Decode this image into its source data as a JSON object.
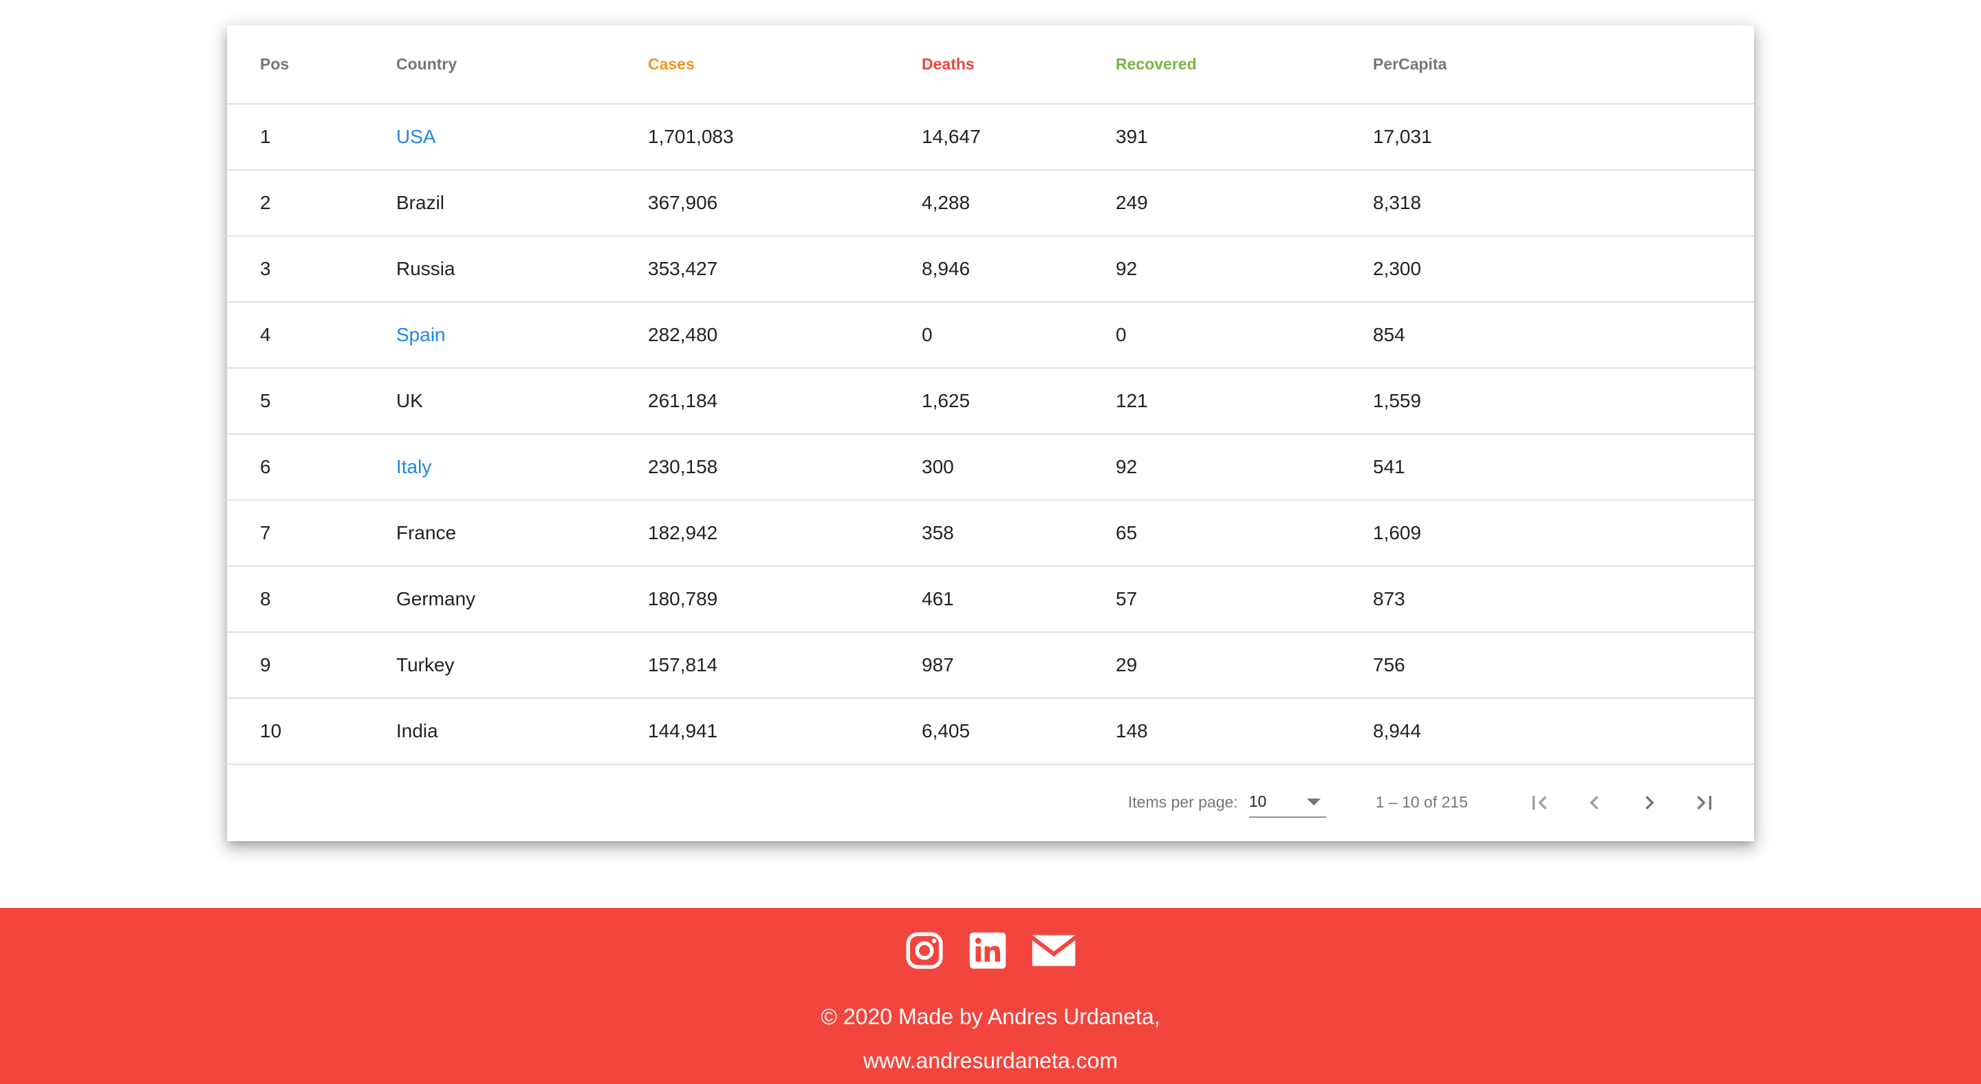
{
  "colors": {
    "cases": "#f7931e",
    "deaths": "#f2453d",
    "recovered": "#7cb342",
    "link": "#1e88e5",
    "footer_bg": "#f2453d"
  },
  "table": {
    "columns": [
      "Pos",
      "Country",
      "Cases",
      "Deaths",
      "Recovered",
      "PerCapita"
    ],
    "rows": [
      {
        "pos": "1",
        "country": "USA",
        "linked": true,
        "cases": "1,701,083",
        "deaths": "14,647",
        "recovered": "391",
        "percapita": "17,031"
      },
      {
        "pos": "2",
        "country": "Brazil",
        "linked": false,
        "cases": "367,906",
        "deaths": "4,288",
        "recovered": "249",
        "percapita": "8,318"
      },
      {
        "pos": "3",
        "country": "Russia",
        "linked": false,
        "cases": "353,427",
        "deaths": "8,946",
        "recovered": "92",
        "percapita": "2,300"
      },
      {
        "pos": "4",
        "country": "Spain",
        "linked": true,
        "cases": "282,480",
        "deaths": "0",
        "recovered": "0",
        "percapita": "854"
      },
      {
        "pos": "5",
        "country": "UK",
        "linked": false,
        "cases": "261,184",
        "deaths": "1,625",
        "recovered": "121",
        "percapita": "1,559"
      },
      {
        "pos": "6",
        "country": "Italy",
        "linked": true,
        "cases": "230,158",
        "deaths": "300",
        "recovered": "92",
        "percapita": "541"
      },
      {
        "pos": "7",
        "country": "France",
        "linked": false,
        "cases": "182,942",
        "deaths": "358",
        "recovered": "65",
        "percapita": "1,609"
      },
      {
        "pos": "8",
        "country": "Germany",
        "linked": false,
        "cases": "180,789",
        "deaths": "461",
        "recovered": "57",
        "percapita": "873"
      },
      {
        "pos": "9",
        "country": "Turkey",
        "linked": false,
        "cases": "157,814",
        "deaths": "987",
        "recovered": "29",
        "percapita": "756"
      },
      {
        "pos": "10",
        "country": "India",
        "linked": false,
        "cases": "144,941",
        "deaths": "6,405",
        "recovered": "148",
        "percapita": "8,944"
      }
    ]
  },
  "paginator": {
    "items_per_page_label": "Items per page:",
    "page_size": "10",
    "range_label": "1 – 10 of 215",
    "buttons": [
      "first-page-icon",
      "previous-page-icon",
      "next-page-icon",
      "last-page-icon"
    ]
  },
  "footer": {
    "social_icons": [
      "instagram-icon",
      "linkedin-icon",
      "mail-icon"
    ],
    "copyright": "© 2020 Made by Andres Urdaneta,",
    "website": "www.andresurdaneta.com"
  }
}
